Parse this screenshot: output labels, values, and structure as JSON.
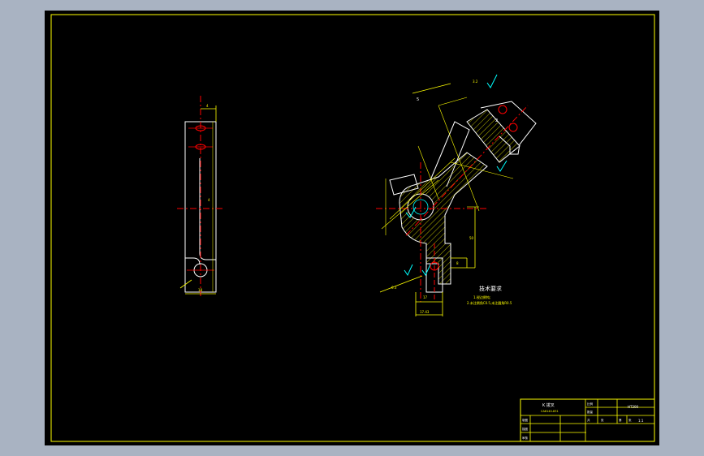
{
  "drawing": {
    "colors": {
      "background": "#a9b3c2",
      "paper": "#000000",
      "border": "#ffff00",
      "outline": "#ffffff",
      "center_line": "#ff0000",
      "dimension": "#ffff00",
      "surface_symbol": "#00ffff"
    },
    "left_view": {
      "dims": [
        "4",
        "18",
        "4"
      ]
    },
    "main_view": {
      "dims": [
        "5",
        "2",
        "17",
        "50",
        "8",
        "17.43"
      ],
      "surface_symbols": [
        "3.2",
        "6.3"
      ],
      "tech_notes": {
        "title": "技术要求",
        "lines": [
          "1.锐边倒钝;",
          "2.未注倒角C0.5,未注圆角R0.5"
        ]
      }
    },
    "title_block": {
      "part_name": "K 拨叉",
      "part_code": "CA6140-831",
      "material": "HT200",
      "scale": "1:1",
      "cells": [
        "比例",
        "数量",
        "共",
        "张",
        "第",
        "张"
      ],
      "roles": [
        "制图",
        "描图",
        "审核"
      ]
    }
  }
}
